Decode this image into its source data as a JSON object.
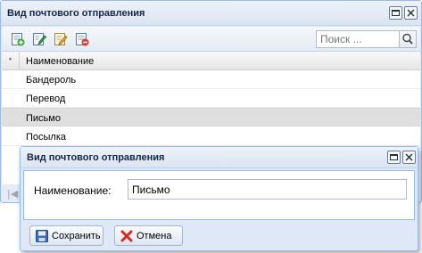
{
  "window": {
    "title": "Вид почтового отправления",
    "restore_tool": "restore-icon",
    "close_tool": "close-icon"
  },
  "toolbar": {
    "icons": [
      "add-icon",
      "edit-icon",
      "edit-form-icon",
      "delete-icon"
    ],
    "search": {
      "placeholder": "Поиск ...",
      "value": "",
      "button_icon": "search-icon"
    }
  },
  "grid": {
    "header_marker": "*",
    "column_name": "Наименование",
    "rows": [
      "Бандероль",
      "Перевод",
      "Письмо",
      "Посылка"
    ],
    "selected_row": "Письмо",
    "pager_first_icon": "first-page-icon"
  },
  "dialog": {
    "title": "Вид почтового отправления",
    "field_label": "Наименование:",
    "field_value": "Письмо",
    "save_label": "Сохранить",
    "cancel_label": "Отмена"
  },
  "colors": {
    "frame_border": "#99bbe8",
    "frame_bg": "#dfe8f6",
    "title_text": "#15284b",
    "selected_row": "#dfdfdf"
  }
}
